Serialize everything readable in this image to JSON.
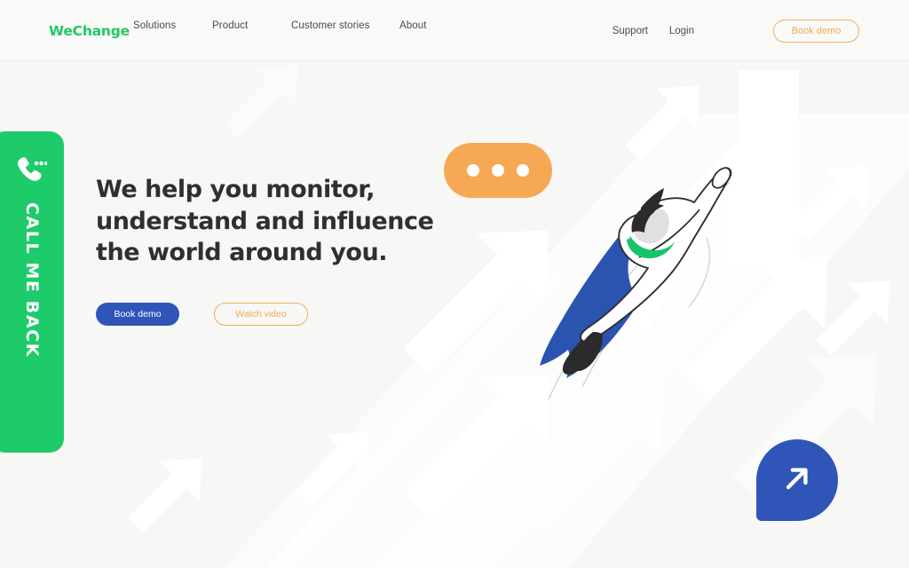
{
  "brand": {
    "name": "WeChange",
    "color": "#22c768"
  },
  "header": {
    "nav": [
      {
        "label": "Solutions"
      },
      {
        "label": "Product"
      },
      {
        "label": "Customer stories"
      },
      {
        "label": "About"
      }
    ],
    "support_label": "Support",
    "login_label": "Login",
    "book_demo_label": "Book demo"
  },
  "call_tab": {
    "label": "CALL ME BACK",
    "icon": "phone-dots-icon",
    "color": "#1ecb6b"
  },
  "hero": {
    "headline_line_1": "We help you monitor,",
    "headline_line_2": "understand and influence",
    "headline_line_3": "the world around you.",
    "primary_button": "Book demo",
    "secondary_button": "Watch video",
    "primary_color": "#2f55b8",
    "secondary_color": "#f0a955"
  },
  "decor": {
    "chat_bubble": {
      "icon": "ellipsis-icon",
      "dots": 3,
      "color": "#f6a855"
    },
    "pin_button": {
      "icon": "arrow-up-right-icon",
      "color": "#2f55b8"
    },
    "background": {
      "icon": "diagonal-arrows-pattern",
      "arrow_color": "#ffffff",
      "page_color": "#f7f7f5"
    },
    "illustration": {
      "name": "flying-superhero-illustration",
      "cape_color": "#2a54b0",
      "collar_color": "#17c46b",
      "hair_color": "#2b2b2b"
    }
  }
}
